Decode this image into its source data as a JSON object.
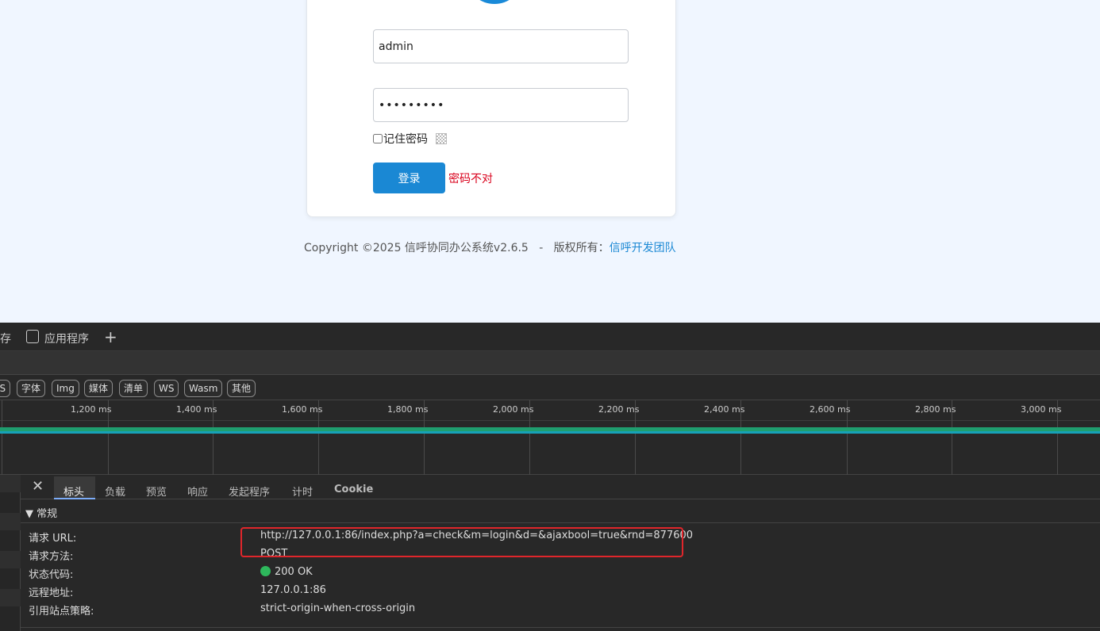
{
  "login": {
    "username_value": "admin",
    "password_value": "•••••••••",
    "remember_label": "记住密码",
    "login_button": "登录",
    "error_message": "密码不对"
  },
  "footer": {
    "copyright": "Copyright ©2025 信呼协同办公系统v2.6.5   -   版权所有：",
    "team_link": "信呼开发团队"
  },
  "devtools": {
    "top_tabs": {
      "partial": "存",
      "application": "应用程序"
    },
    "filters": [
      "JS",
      "字体",
      "Img",
      "媒体",
      "清单",
      "WS",
      "Wasm",
      "其他"
    ],
    "ticks": [
      "1,200 ms",
      "1,400 ms",
      "1,600 ms",
      "1,800 ms",
      "2,000 ms",
      "2,200 ms",
      "2,400 ms",
      "2,600 ms",
      "2,800 ms",
      "3,000 ms"
    ],
    "panel_tabs": [
      "标头",
      "负载",
      "预览",
      "响应",
      "发起程序",
      "计时",
      "Cookie"
    ],
    "general_header": "▼ 常规",
    "general": [
      {
        "key": "请求 URL:",
        "value": "http://127.0.0.1:86/index.php?a=check&m=login&d=&ajaxbool=true&rnd=877600"
      },
      {
        "key": "请求方法:",
        "value": "POST"
      },
      {
        "key": "状态代码:",
        "value": "200 OK"
      },
      {
        "key": "远程地址:",
        "value": "127.0.0.1:86"
      },
      {
        "key": "引用站点策略:",
        "value": "strict-origin-when-cross-origin"
      }
    ],
    "status_color": "#2eb85c",
    "highlight_color": "#e0262b"
  }
}
